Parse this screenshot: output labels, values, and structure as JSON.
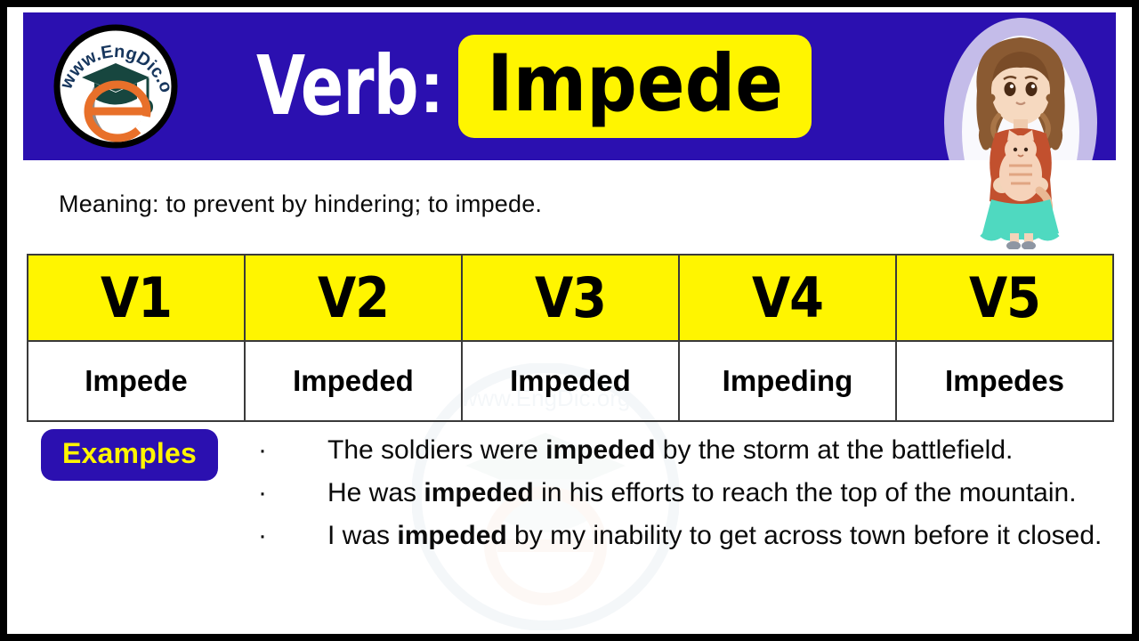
{
  "brand": {
    "logo_text": "www.EngDic.org",
    "logo_letter": "e",
    "accent_blue": "#2B10B0",
    "accent_yellow": "#FFF500",
    "logo_green": "#17463F",
    "logo_orange": "#E8702A"
  },
  "header": {
    "label": "Verb",
    "separator": ":",
    "word": "Impede",
    "illustration": "girl-holding-cat-illustration"
  },
  "meaning": {
    "text": "Meaning: to prevent by hindering; to impede."
  },
  "table": {
    "headers": [
      "V1",
      "V2",
      "V3",
      "V4",
      "V5"
    ],
    "forms": [
      "Impede",
      "Impeded",
      "Impeded",
      "Impeding",
      "Impedes"
    ]
  },
  "examples": {
    "badge_label": "Examples",
    "bullet": "·",
    "items": [
      {
        "before": "The soldiers were ",
        "bold": "impeded",
        "after": " by the storm at the battlefield."
      },
      {
        "before": "He was ",
        "bold": "impeded",
        "after": " in his efforts to reach the top of the mountain."
      },
      {
        "before": "I was ",
        "bold": "impeded",
        "after": " by my inability to get across town before it closed."
      }
    ]
  },
  "watermark": {
    "text": "www.EngDic.org"
  }
}
